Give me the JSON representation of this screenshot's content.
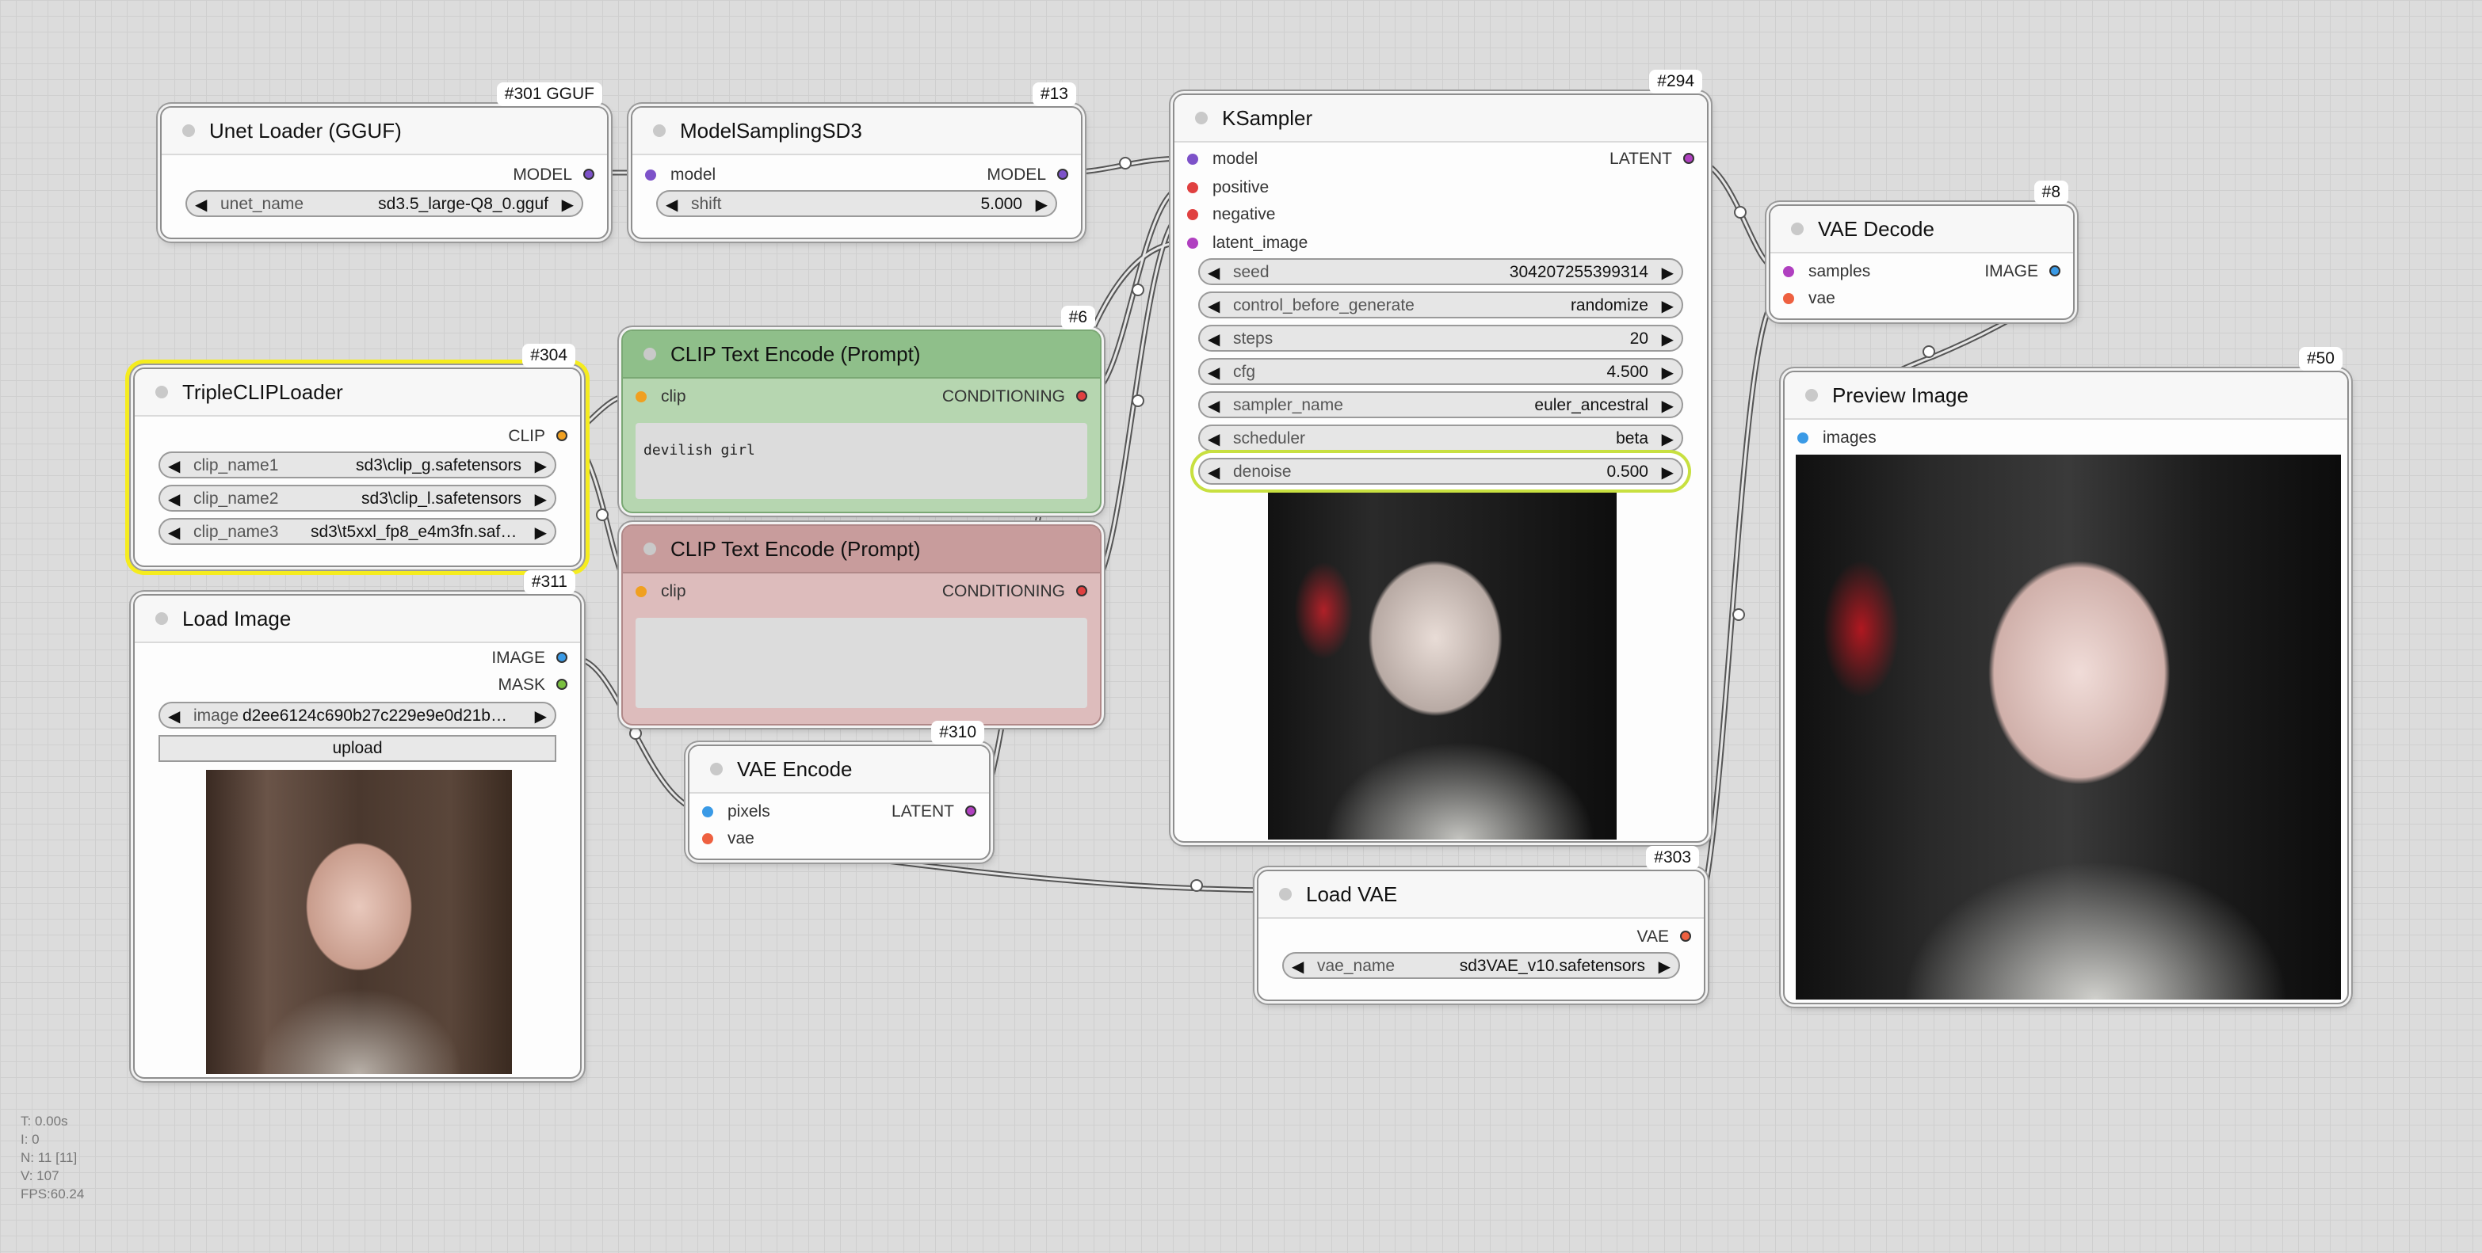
{
  "nodes": {
    "unet": {
      "id": "#301 GGUF",
      "title": "Unet Loader (GGUF)",
      "out": "MODEL",
      "w_name": "unet_name",
      "w_val": "sd3.5_large-Q8_0.gguf"
    },
    "msd3": {
      "id": "#13",
      "title": "ModelSamplingSD3",
      "in": "model",
      "out": "MODEL",
      "w_name": "shift",
      "w_val": "5.000"
    },
    "triple": {
      "id": "#304",
      "title": "TripleCLIPLoader",
      "out": "CLIP",
      "w": [
        {
          "n": "clip_name1",
          "v": "sd3\\clip_g.safetensors"
        },
        {
          "n": "clip_name2",
          "v": "sd3\\clip_l.safetensors"
        },
        {
          "n": "clip_name3",
          "v": "sd3\\t5xxl_fp8_e4m3fn.safet…"
        }
      ]
    },
    "loadimg": {
      "id": "#311",
      "title": "Load Image",
      "out1": "IMAGE",
      "out2": "MASK",
      "w_name": "image",
      "w_val": "d2ee6124c690b27c229e9e0d21b…",
      "upload": "upload"
    },
    "clip_pos": {
      "id": "#6",
      "title": "CLIP Text Encode (Prompt)",
      "in": "clip",
      "out": "CONDITIONING",
      "text": "devilish girl"
    },
    "clip_neg": {
      "title": "CLIP Text Encode (Prompt)",
      "in": "clip",
      "out": "CONDITIONING",
      "text": ""
    },
    "vaeenc": {
      "id": "#310",
      "title": "VAE Encode",
      "in1": "pixels",
      "in2": "vae",
      "out": "LATENT"
    },
    "ksampler": {
      "id": "#294",
      "title": "KSampler",
      "ins": [
        "model",
        "positive",
        "negative",
        "latent_image"
      ],
      "out": "LATENT",
      "w": [
        {
          "n": "seed",
          "v": "304207255399314"
        },
        {
          "n": "control_before_generate",
          "v": "randomize"
        },
        {
          "n": "steps",
          "v": "20"
        },
        {
          "n": "cfg",
          "v": "4.500"
        },
        {
          "n": "sampler_name",
          "v": "euler_ancestral"
        },
        {
          "n": "scheduler",
          "v": "beta"
        },
        {
          "n": "denoise",
          "v": "0.500"
        }
      ]
    },
    "vaedec": {
      "id": "#8",
      "title": "VAE Decode",
      "in1": "samples",
      "in2": "vae",
      "out": "IMAGE"
    },
    "preview": {
      "id": "#50",
      "title": "Preview Image",
      "in": "images"
    },
    "loadvae": {
      "id": "#303",
      "title": "Load VAE",
      "out": "VAE",
      "w_name": "vae_name",
      "w_val": "sd3VAE_v10.safetensors"
    }
  },
  "stats": [
    "T: 0.00s",
    "I: 0",
    "N: 11 [11]",
    "V: 107",
    "FPS:60.24"
  ],
  "colors": {
    "model": "#7d52c9",
    "clip": "#f0a020",
    "conditioning": "#e04040",
    "latent": "#b040c0",
    "image": "#3a9ae6",
    "mask": "#7ac040",
    "vae": "#ee6040",
    "selected": "#f5ec1e",
    "positive_node": "#a9cfa4",
    "negative_node": "#d5a8a8"
  }
}
